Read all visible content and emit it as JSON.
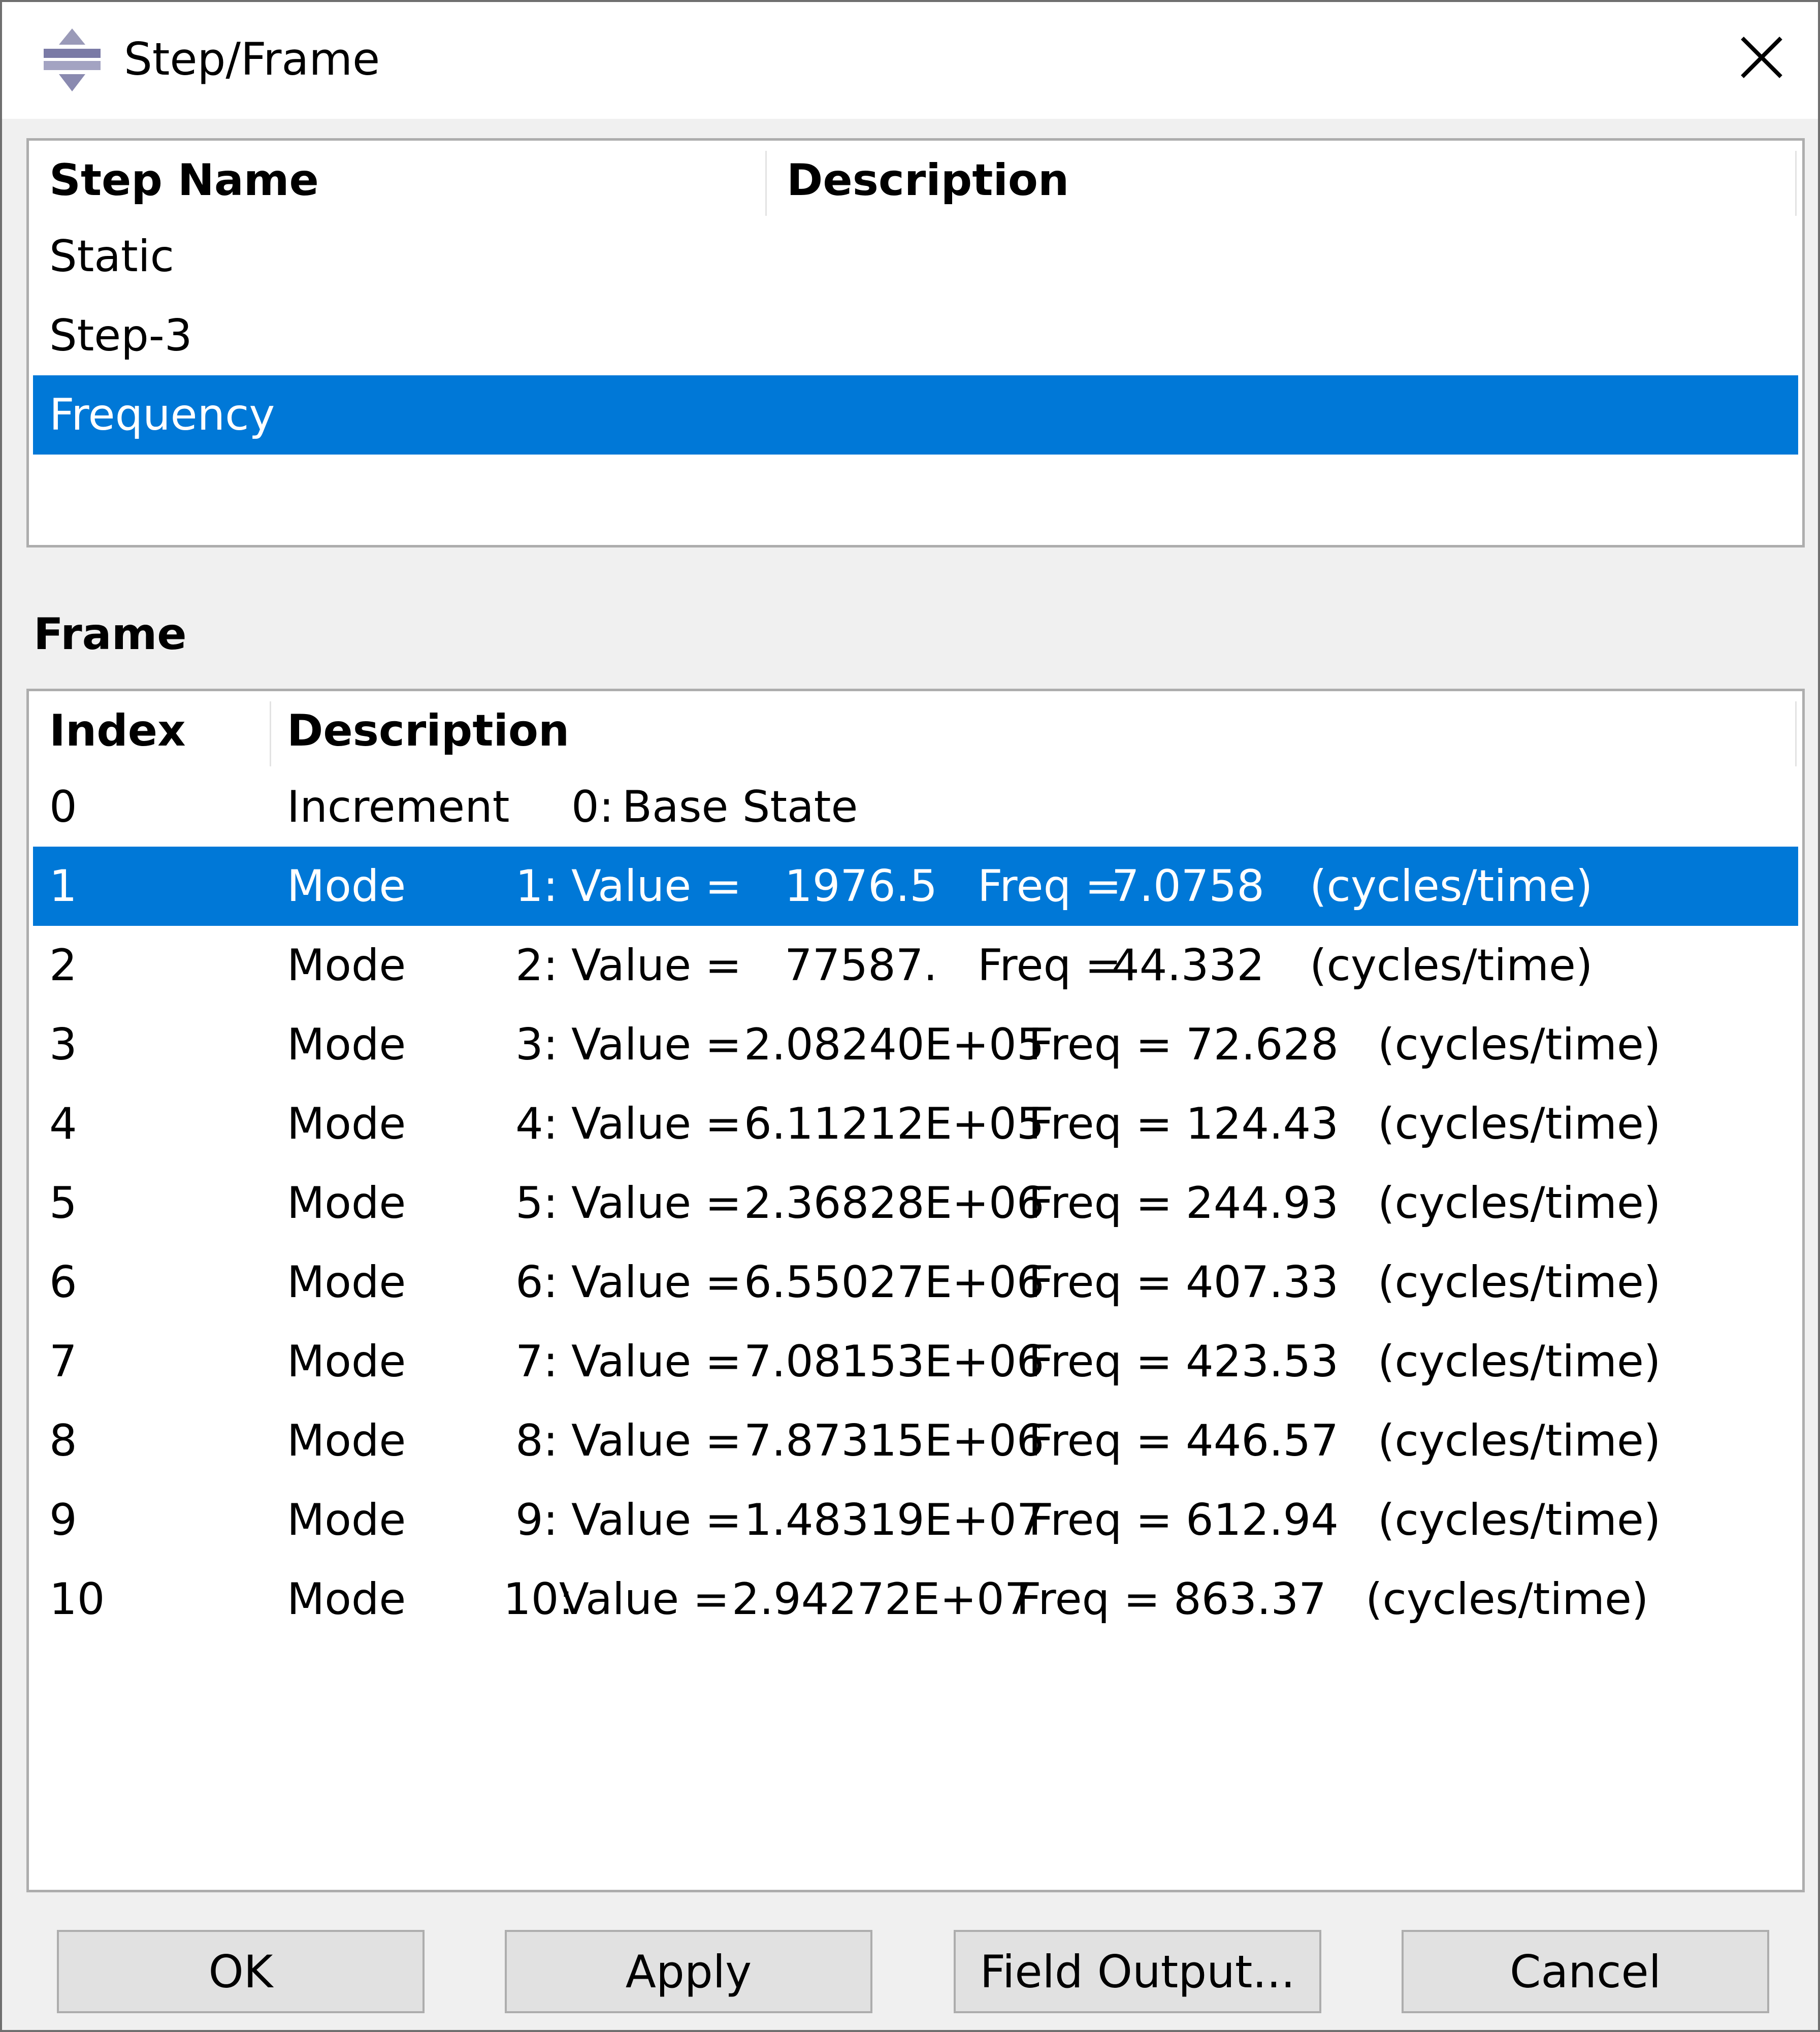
{
  "window": {
    "title": "Step/Frame",
    "icon": "step-frame-app-icon",
    "close_icon": "close-icon"
  },
  "step_table": {
    "headers": [
      "Step Name",
      "Description"
    ],
    "rows": [
      {
        "name": "Static",
        "description": ""
      },
      {
        "name": "Step-3",
        "description": ""
      },
      {
        "name": "Frequency",
        "description": ""
      }
    ],
    "selected_index": 2
  },
  "frame_section": {
    "label": "Frame",
    "headers": [
      "Index",
      "Description"
    ],
    "rows": [
      {
        "index": "0",
        "kind": "Increment",
        "num": "0:",
        "value_label": "Base State",
        "value": "",
        "freq_label": "",
        "freq": "",
        "unit": ""
      },
      {
        "index": "1",
        "kind": "Mode",
        "num": "1:",
        "value_label": "Value =",
        "value": "1976.5",
        "freq_label": "Freq =",
        "freq": "7.0758",
        "unit": "(cycles/time)"
      },
      {
        "index": "2",
        "kind": "Mode",
        "num": "2:",
        "value_label": "Value =",
        "value": "77587.",
        "freq_label": "Freq =",
        "freq": "44.332",
        "unit": "(cycles/time)"
      },
      {
        "index": "3",
        "kind": "Mode",
        "num": "3:",
        "value_label": "Value =",
        "value": "2.08240E+05",
        "freq_label": "Freq =",
        "freq": "72.628",
        "unit": "(cycles/time)"
      },
      {
        "index": "4",
        "kind": "Mode",
        "num": "4:",
        "value_label": "Value =",
        "value": "6.11212E+05",
        "freq_label": "Freq =",
        "freq": "124.43",
        "unit": "(cycles/time)"
      },
      {
        "index": "5",
        "kind": "Mode",
        "num": "5:",
        "value_label": "Value =",
        "value": "2.36828E+06",
        "freq_label": "Freq =",
        "freq": "244.93",
        "unit": "(cycles/time)"
      },
      {
        "index": "6",
        "kind": "Mode",
        "num": "6:",
        "value_label": "Value =",
        "value": "6.55027E+06",
        "freq_label": "Freq =",
        "freq": "407.33",
        "unit": "(cycles/time)"
      },
      {
        "index": "7",
        "kind": "Mode",
        "num": "7:",
        "value_label": "Value =",
        "value": "7.08153E+06",
        "freq_label": "Freq =",
        "freq": "423.53",
        "unit": "(cycles/time)"
      },
      {
        "index": "8",
        "kind": "Mode",
        "num": "8:",
        "value_label": "Value =",
        "value": "7.87315E+06",
        "freq_label": "Freq =",
        "freq": "446.57",
        "unit": "(cycles/time)"
      },
      {
        "index": "9",
        "kind": "Mode",
        "num": "9:",
        "value_label": "Value =",
        "value": "1.48319E+07",
        "freq_label": "Freq =",
        "freq": "612.94",
        "unit": "(cycles/time)"
      },
      {
        "index": "10",
        "kind": "Mode",
        "num": "10:",
        "value_label": "Value =",
        "value": "2.94272E+07",
        "freq_label": "Freq =",
        "freq": "863.37",
        "unit": "(cycles/time)"
      }
    ],
    "selected_index": 1
  },
  "buttons": {
    "ok": "OK",
    "apply": "Apply",
    "field_output": "Field Output...",
    "cancel": "Cancel"
  },
  "colors": {
    "selection": "#0078d7",
    "selection_text": "#ffffff",
    "dialog_bg": "#f0f0f0",
    "button_bg": "#e1e1e1"
  }
}
